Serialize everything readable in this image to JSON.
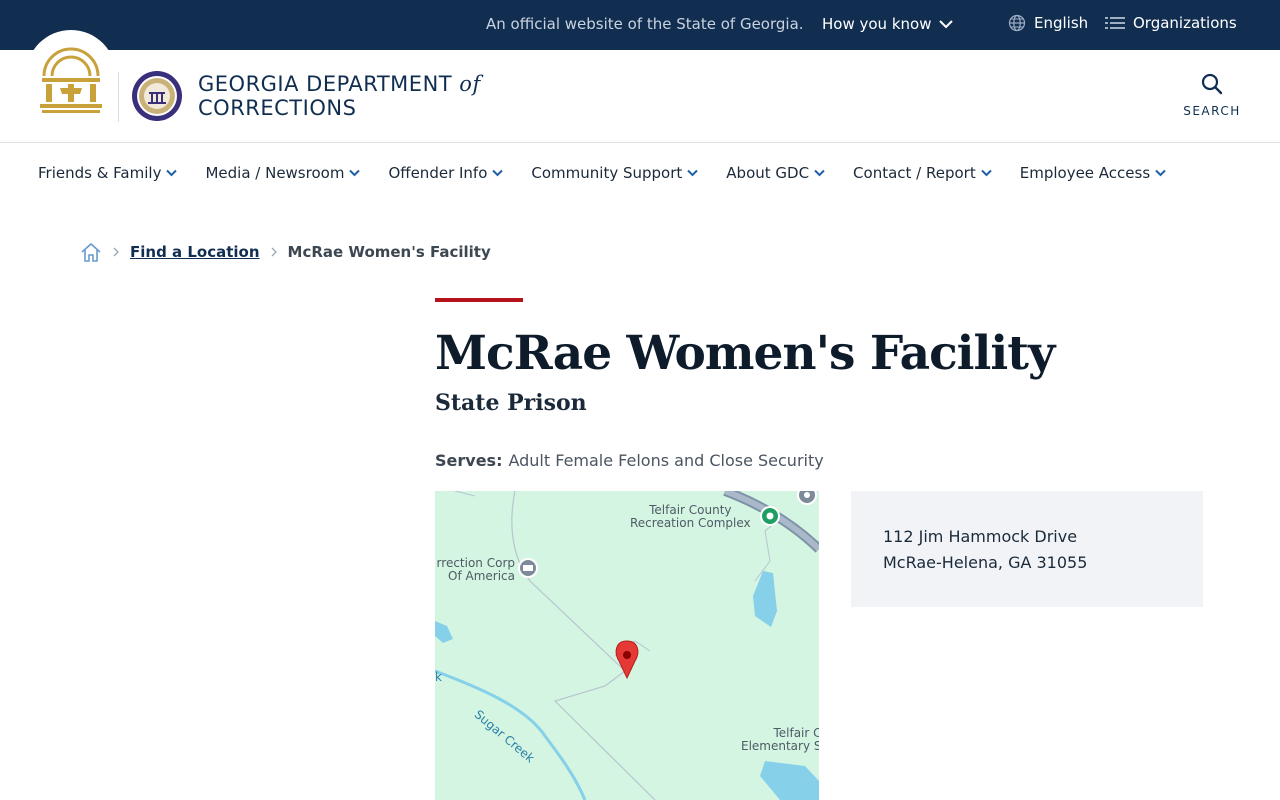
{
  "topbar": {
    "official_text": "An official website of the State of Georgia.",
    "how_you_know": "How you know",
    "language": "English",
    "organizations": "Organizations"
  },
  "header": {
    "brand_line1": "GEORGIA DEPARTMENT",
    "brand_of": "of",
    "brand_line2": "CORRECTIONS",
    "search_label": "SEARCH"
  },
  "nav": {
    "items": [
      {
        "label": "Friends & Family"
      },
      {
        "label": "Media / Newsroom"
      },
      {
        "label": "Offender Info"
      },
      {
        "label": "Community Support"
      },
      {
        "label": "About GDC"
      },
      {
        "label": "Contact / Report"
      },
      {
        "label": "Employee Access"
      }
    ]
  },
  "breadcrumb": {
    "link": "Find a Location",
    "current": "McRae Women's Facility"
  },
  "main": {
    "title": "McRae Women's Facility",
    "subtitle": "State Prison",
    "serves_label": "Serves:",
    "serves_value": "Adult Female Felons and Close Security"
  },
  "map": {
    "labels": {
      "telfair_rec": "Telfair County\nRecreation Complex",
      "correction_corp": "rrection Corp\nOf America",
      "sugar_creek": "Sugar Creek",
      "telfair_elem": "Telfair C\nElementary S",
      "creek_k": "k"
    }
  },
  "address": {
    "line1": "112 Jim Hammock Drive",
    "line2": "McRae-Helena, GA 31055"
  },
  "colors": {
    "topbar_bg": "#112e51",
    "accent_red": "#b5121b",
    "seal_gold": "#c9a13b",
    "map_green": "#d4f5e2",
    "map_water": "#86d0ea",
    "pin_red": "#e53935"
  }
}
